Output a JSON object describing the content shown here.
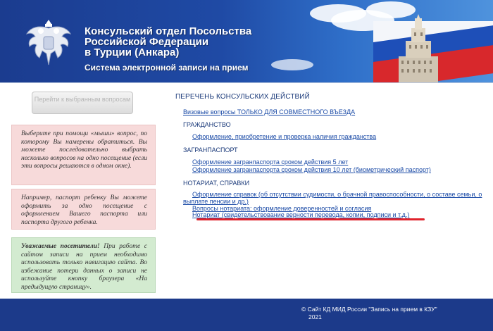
{
  "header": {
    "title_lines": [
      "Консульский отдел Посольства",
      "Российской Федерации",
      "в Турции (Анкара)"
    ],
    "subtitle": "Система электронной записи на прием"
  },
  "sidebar": {
    "go_button_label": "Перейти к выбранным вопросам",
    "note1": "Выберите при помощи «мыши» вопрос, по которому Вы намерены обратиться. Вы можете последовательно выбрать несколько вопросов на одно посещение (если эти вопросы решаются в одном окне).",
    "note2": "Например, паспорт ребенку Вы можете оформить за одно посещение с оформлением Вашего паспорта или паспорта другого ребенка.",
    "note3_bold": "Уважаемые посетители!",
    "note3_text": " При работе с сайтом записи на прием необходимо использовать только навигацию сайта. Во избежание потери данных о записи не используйте кнопку браузера «На предыдущую страницу»."
  },
  "main": {
    "heading": "ПЕРЕЧЕНЬ КОНСУЛЬСКИХ ДЕЙСТВИЙ",
    "visa_link": "Визовые вопросы ТОЛЬКО ДЛЯ СОВМЕСТНОГО ВЪЕЗДА",
    "cat_citizenship": "ГРАЖДАНСТВО",
    "citizenship_link": "Оформление, приобретение и проверка наличия гражданства",
    "cat_passport": "ЗАГРАНПАСПОРТ",
    "passport_link1": "Оформление загранпаспорта сроком действия 5 лет",
    "passport_link2": "Оформление загранпаспорта сроком действия 10 лет (биометрический паспорт)",
    "cat_notary": "НОТАРИАТ, СПРАВКИ",
    "notary_link1_line1": "Оформление справок (об отсутствии судимости, о брачной правоспособности, о составе семьи, о",
    "notary_link1_line2": "выплате пенсии и др.)",
    "notary_link2": "Вопросы нотариата: оформление доверенностей и согласия",
    "notary_link3": "Нотариат (свидетельствование верности перевода, копии, подписи и т.д.)"
  },
  "footer": {
    "line1": "© Сайт КД МИД России \"Запись на прием в КЗУ\"",
    "line2": "2021"
  },
  "colors": {
    "header_blue": "#1c3a8a",
    "link_blue": "#1a4aa6",
    "highlight_red": "#e0232c",
    "note_pink": "#f7dada",
    "note_green": "#d3ebd0"
  }
}
